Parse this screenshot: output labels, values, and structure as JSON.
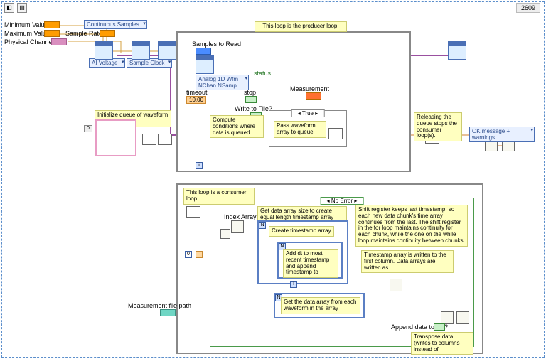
{
  "toolbar": {
    "page": "2609"
  },
  "controls": {
    "min_val": "Minimum Value",
    "max_val": "Maximum Value",
    "phys_chan": "Physical Channel",
    "sample_rate": "Sample Rate",
    "cont_samples": "Continuous Samples",
    "ai_voltage": "AI Voltage",
    "sample_clock": "Sample Clock"
  },
  "producer": {
    "title": "This loop is the producer loop.",
    "samples_to_read": "Samples to Read",
    "read_mode": "Analog 1D Wfm NChan NSamp",
    "timeout_lbl": "timeout",
    "timeout_val": "10.00",
    "stop_lbl": "stop",
    "status_lbl": "status",
    "measurement": "Measurement",
    "write_to_file": "Write to File?",
    "compute_note": "Compute conditions where data is queued.",
    "case_true": "True",
    "pass_note": "Pass waveform array to queue",
    "release_note": "Releasing the queue stops the consumer loop(s).",
    "ok_msg": "OK message + warnings"
  },
  "queue": {
    "init_note": "Initialize queue of waveform array"
  },
  "consumer": {
    "title": "This loop is a consumer loop.",
    "case_noerr": "No Error",
    "index_array": "Index Array",
    "get_size_note": "Get data array size to create equal length timestamp array",
    "create_ts_note": "Create timestamp array",
    "add_dt_note": "Add dt to most recent timestamp and append timestamp to",
    "shift_note": "Shift register keeps last timestamp, so each new data chunk's time array continues from the last. The shift register in the for loop maintains continuity for each chunk, while the one on the while loop maintains continuity between chunks.",
    "ts_written_note": "Timestamp array is written to the first column. Data arrays are written as",
    "get_data_note": "Get the data array from each waveform in the array",
    "append_lbl": "Append data to file?",
    "transpose_note": "Transpose data (writes to columns instead of",
    "meas_file_path": "Measurement file path",
    "zero": "0"
  }
}
